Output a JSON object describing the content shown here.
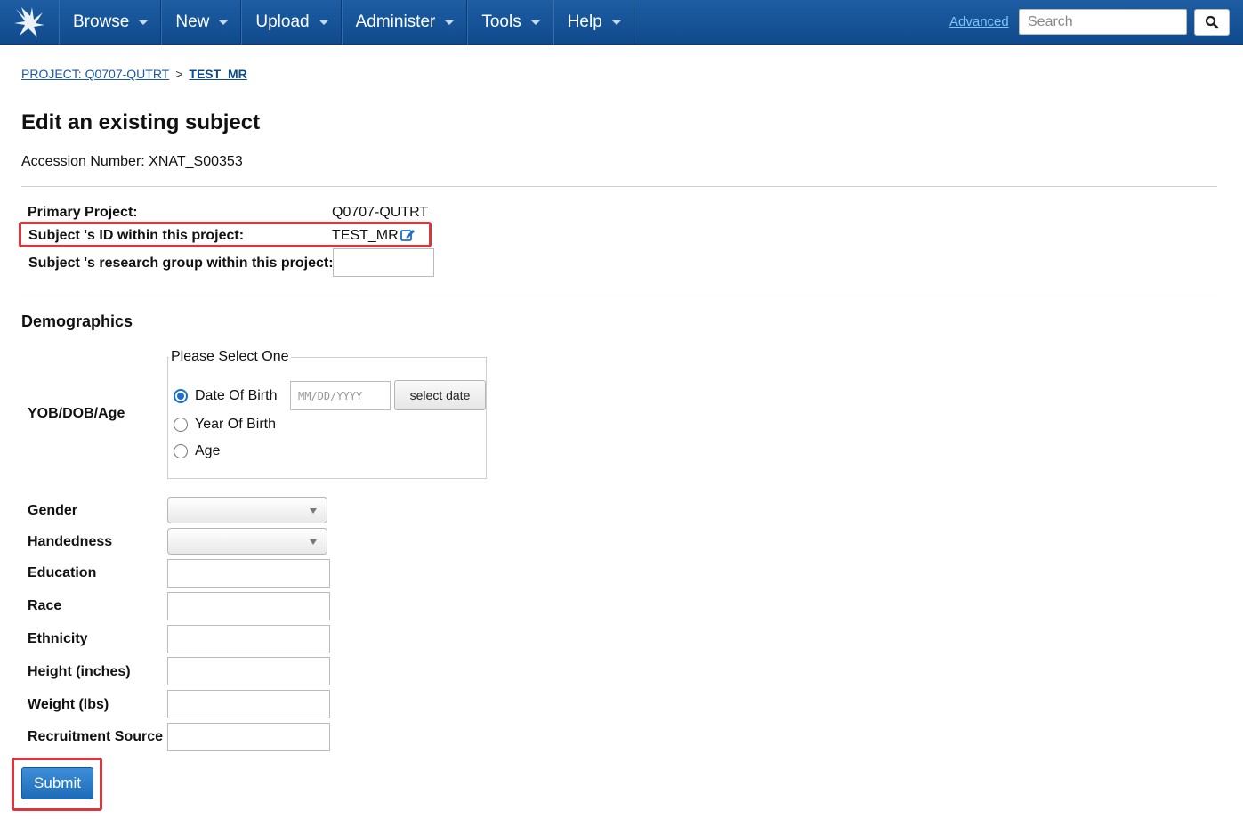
{
  "nav": {
    "items": [
      {
        "label": "Browse"
      },
      {
        "label": "New"
      },
      {
        "label": "Upload"
      },
      {
        "label": "Administer"
      },
      {
        "label": "Tools"
      },
      {
        "label": "Help"
      }
    ],
    "advanced_label": "Advanced",
    "search_placeholder": "Search"
  },
  "breadcrumb": {
    "project": "PROJECT: Q0707-QUTRT",
    "separator": ">",
    "current": "TEST_MR"
  },
  "page": {
    "title": "Edit an existing subject",
    "accession": "Accession Number: XNAT_S00353"
  },
  "project_info": {
    "primary_label": "Primary Project:",
    "primary_value": "Q0707-QUTRT",
    "id_label": "Subject 's ID within this project:",
    "id_value": "TEST_MR",
    "group_label": "Subject 's research group within this project:",
    "group_value": ""
  },
  "demographics": {
    "heading": "Demographics",
    "yob_label": "YOB/DOB/Age",
    "fieldset_legend": "Please Select One",
    "options": [
      {
        "label": "Date Of Birth",
        "checked": true
      },
      {
        "label": "Year Of Birth",
        "checked": false
      },
      {
        "label": "Age",
        "checked": false
      }
    ],
    "date_placeholder": "MM/DD/YYYY",
    "select_date_label": "select date",
    "gender_label": "Gender",
    "gender_value": "",
    "handedness_label": "Handedness",
    "handedness_value": "",
    "education_label": "Education",
    "education_value": "",
    "race_label": "Race",
    "race_value": "",
    "ethnicity_label": "Ethnicity",
    "ethnicity_value": "",
    "height_label": "Height (inches)",
    "height_value": "",
    "weight_label": "Weight (lbs)",
    "weight_value": "",
    "recruitment_label": "Recruitment Source",
    "recruitment_value": ""
  },
  "actions": {
    "submit_label": "Submit"
  },
  "colors": {
    "navbar": "#1a5599",
    "link": "#1a5aa6",
    "highlight": "#d9363e",
    "submit": "#2a7cc7"
  },
  "icons": {
    "logo": "xnat-logo-icon",
    "search": "magnifier-icon",
    "edit": "edit-icon"
  }
}
